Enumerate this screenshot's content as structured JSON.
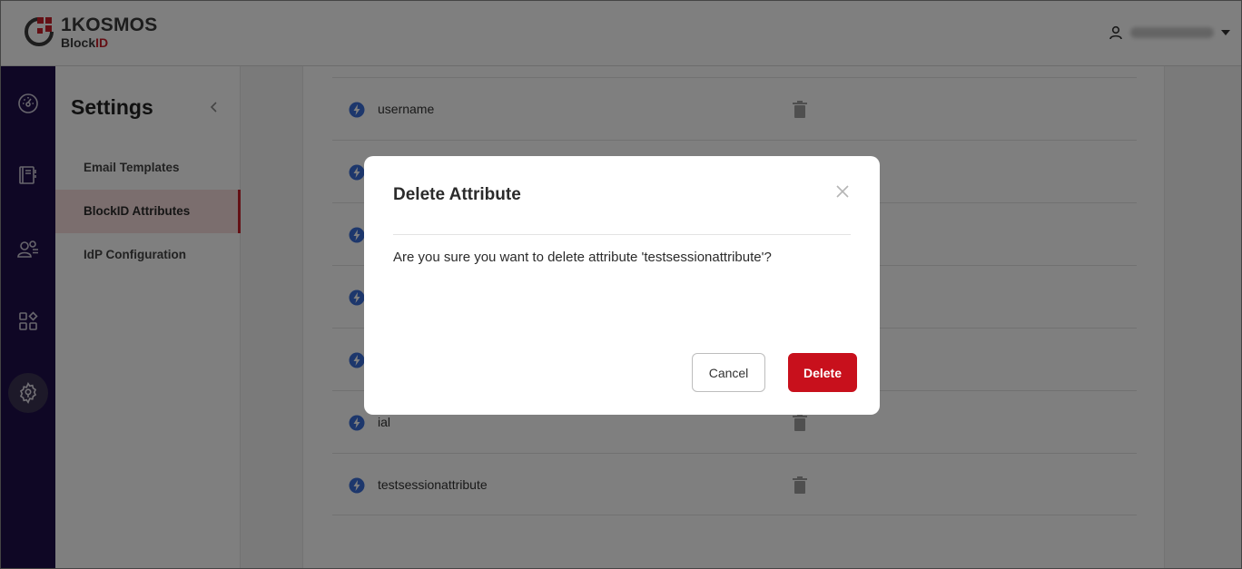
{
  "header": {
    "brand_name": "1KOSMOS",
    "brand_sub_prefix": "Block",
    "brand_sub_accent": "ID",
    "user_icon": "user-icon",
    "user_menu_icon": "caret-down-icon"
  },
  "rail": {
    "items": [
      {
        "icon": "dashboard-icon"
      },
      {
        "icon": "directory-icon"
      },
      {
        "icon": "users-icon"
      },
      {
        "icon": "apps-icon"
      },
      {
        "icon": "settings-icon",
        "active": true
      }
    ]
  },
  "sidenav": {
    "title": "Settings",
    "collapse_icon": "chevron-left-icon",
    "items": [
      {
        "label": "Email Templates"
      },
      {
        "label": "BlockID Attributes",
        "active": true
      },
      {
        "label": "IdP Configuration"
      }
    ]
  },
  "attributes": [
    {
      "name": "username"
    },
    {
      "name": ""
    },
    {
      "name": ""
    },
    {
      "name": ""
    },
    {
      "name": ""
    },
    {
      "name": "ial"
    },
    {
      "name": "testsessionattribute"
    }
  ],
  "modal": {
    "title": "Delete Attribute",
    "message": "Are you sure you want to delete attribute 'testsessionattribute'?",
    "cancel_label": "Cancel",
    "delete_label": "Delete",
    "close_icon": "close-icon"
  },
  "colors": {
    "brand_accent": "#c8202a",
    "rail_bg": "#1e0f4a",
    "delete_button": "#c8101c",
    "attr_icon": "#3b6fd8"
  }
}
